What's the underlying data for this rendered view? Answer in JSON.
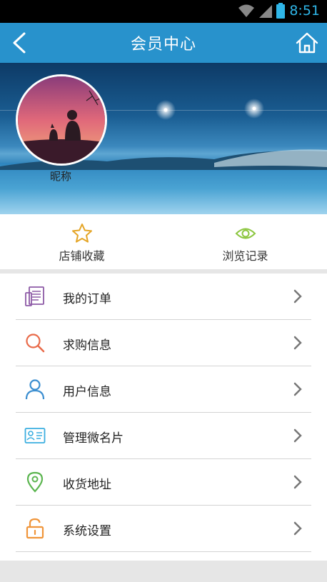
{
  "status_bar": {
    "time": "8:51",
    "icons": [
      "wifi-icon",
      "signal-icon",
      "battery-icon"
    ]
  },
  "app_bar": {
    "title": "会员中心",
    "back_icon": "back-arrow-icon",
    "home_icon": "home-icon"
  },
  "profile": {
    "nickname": "昵称"
  },
  "quick_actions": [
    {
      "label": "店铺收藏",
      "icon": "star-icon",
      "color": "#e4a526"
    },
    {
      "label": "浏览记录",
      "icon": "eye-icon",
      "color": "#8cc63f"
    }
  ],
  "menu": [
    {
      "label": "我的订单",
      "icon": "order-list-icon",
      "color": "#8d5aa6"
    },
    {
      "label": "求购信息",
      "icon": "search-icon",
      "color": "#e96b4a"
    },
    {
      "label": "用户信息",
      "icon": "user-icon",
      "color": "#3b8ed0"
    },
    {
      "label": "管理微名片",
      "icon": "business-card-icon",
      "color": "#3aaee0"
    },
    {
      "label": "收货地址",
      "icon": "location-pin-icon",
      "color": "#5bb54f"
    },
    {
      "label": "系统设置",
      "icon": "unlock-icon",
      "color": "#f0953a"
    }
  ],
  "colors": {
    "accent": "#2892cc",
    "status_bar_bg": "#000000",
    "time_color": "#2fb6e8"
  }
}
